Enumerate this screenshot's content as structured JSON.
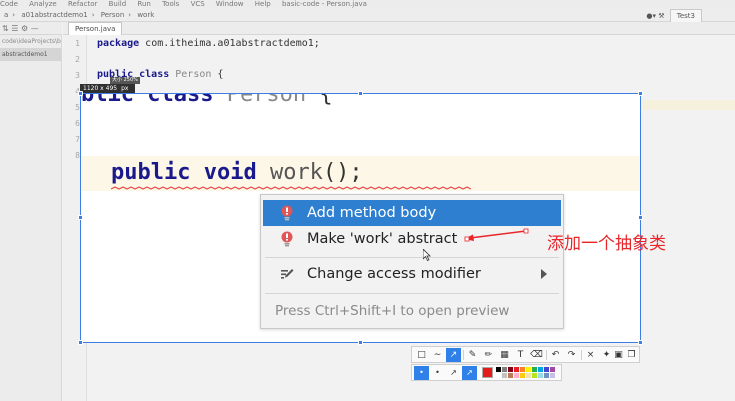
{
  "ide": {
    "menu": [
      "Code",
      "Analyze",
      "Refactor",
      "Build",
      "Run",
      "Tools",
      "VCS",
      "Window",
      "Help",
      "basic-code - Person.java"
    ],
    "breadcrumbs": [
      "a",
      "a01abstractdemo1",
      "Person",
      "work"
    ],
    "run_config": "Test3",
    "project_tree": [
      "code\\ideaProjects\\ba",
      "abstractdemo1"
    ],
    "tab": "Person.java",
    "line_numbers": [
      "1",
      "2",
      "3",
      "4",
      "5",
      "6",
      "7",
      "8"
    ],
    "code": {
      "line1_kw": "package",
      "line1_rest": " com.itheima.a01abstractdemo1;",
      "line3_kw": "public class",
      "line3_name": " Person",
      "line3_brace": " {"
    }
  },
  "capture": {
    "size_label": "1120 x 495",
    "unit": "px",
    "zoom_label": "大小 250%"
  },
  "zoomed_code": {
    "class_kw": "blic class",
    "class_name": " Person",
    "class_brace": " {",
    "method_kw": "public void",
    "method_name": " work",
    "method_paren": "();"
  },
  "popup": {
    "items": [
      {
        "label": "Add method body",
        "icon": "error-bulb-icon",
        "selected": true
      },
      {
        "label": "Make 'work' abstract",
        "icon": "error-bulb-icon",
        "selected": false
      },
      {
        "label": "Change access modifier",
        "icon": "edit-pen-icon",
        "selected": false,
        "has_submenu": true
      }
    ],
    "hint": "Press Ctrl+Shift+I to open preview"
  },
  "annotation": {
    "text": "添加一个抽象类",
    "color": "#e8262a"
  },
  "toolbar": {
    "tools": [
      "rectangle-select-icon",
      "line-icon",
      "arrow-icon",
      "pencil-icon",
      "marker-icon",
      "mosaic-icon",
      "text-icon",
      "eraser-icon",
      "undo-icon",
      "redo-icon",
      "close-icon",
      "pin-icon",
      "save-icon",
      "copy-icon"
    ],
    "active_tool": "arrow-icon",
    "current_color": "#e31b1b",
    "palette": [
      "#000000",
      "#7f7f7f",
      "#880015",
      "#ed1c24",
      "#ff7f27",
      "#fff200",
      "#22b14c",
      "#00a2e8",
      "#3f48cc",
      "#a349a4",
      "#ffffff",
      "#c3c3c3",
      "#b97a57",
      "#ffaec9",
      "#ffc90e",
      "#efe4b0",
      "#b5e61d",
      "#99d9ea",
      "#7092be",
      "#c8bfe7"
    ]
  },
  "colors": {
    "accent": "#3c7de6",
    "selection": "#2f7fd0",
    "keyword": "#1a1a8c"
  }
}
